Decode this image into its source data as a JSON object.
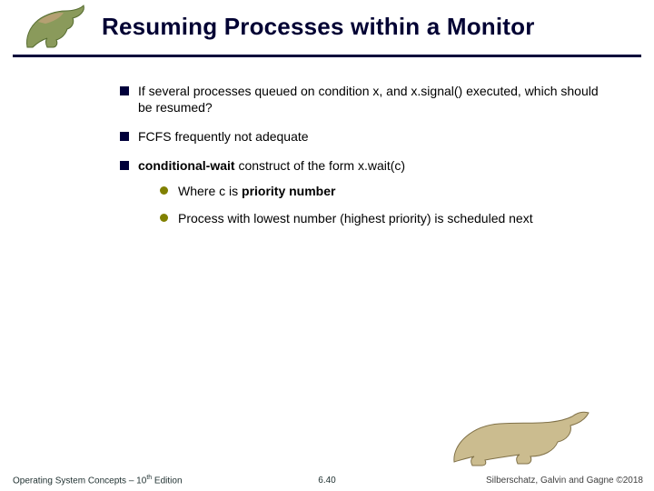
{
  "title": "Resuming Processes within a Monitor",
  "bullets": {
    "b1": "If several processes queued on condition x, and x.signal() executed, which should be resumed?",
    "b2": "FCFS frequently not adequate",
    "b3_pre": "conditional-wait",
    "b3_post": " construct of the form x.wait(c)",
    "b3a_pre": "Where c is ",
    "b3a_bold": "priority number",
    "b3b": "Process with lowest number (highest priority) is scheduled next"
  },
  "footer": {
    "left_pre": "Operating System Concepts – 10",
    "left_sup": "th",
    "left_post": " Edition",
    "center": "6.40",
    "right": "Silberschatz, Galvin and Gagne ©2018"
  }
}
